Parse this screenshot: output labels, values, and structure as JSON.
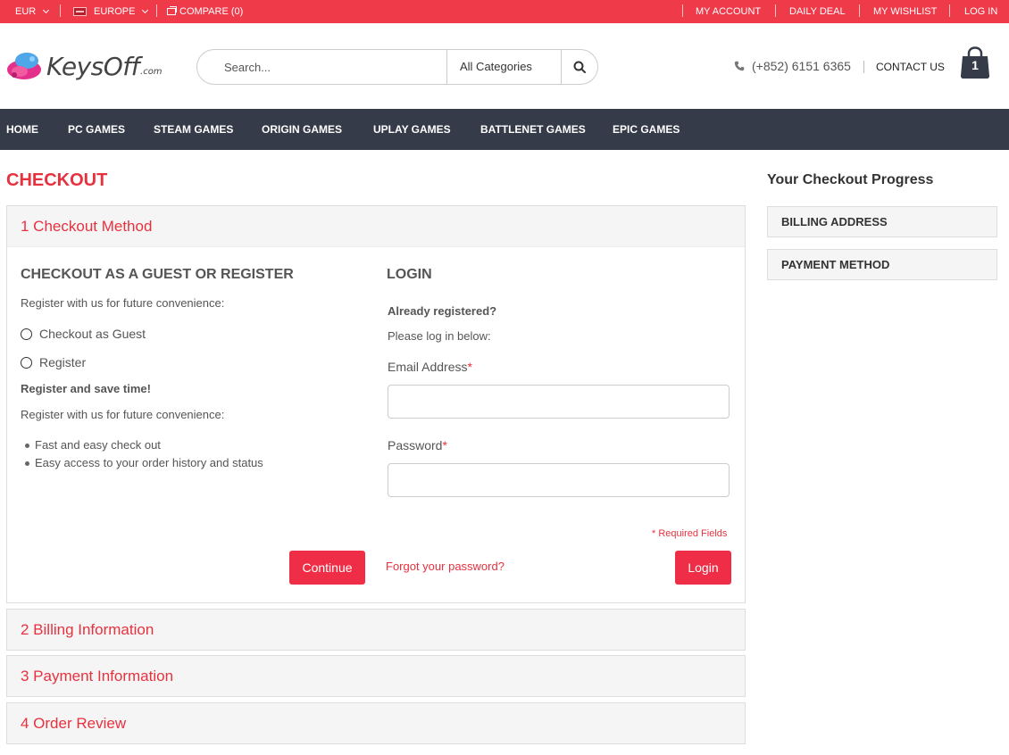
{
  "topbar": {
    "currency": "EUR",
    "region": "EUROPE",
    "compare": "COMPARE (0)",
    "links": [
      "MY ACCOUNT",
      "DAILY DEAL",
      "MY WISHLIST",
      "LOG IN"
    ]
  },
  "header": {
    "logo_text": "KeysOff",
    "logo_suffix": ".com",
    "search_placeholder": "Search...",
    "category": "All Categories",
    "phone": "(+852) 6151 6365",
    "contact": "CONTACT US",
    "cart_count": "1"
  },
  "nav": [
    "HOME",
    "PC GAMES",
    "STEAM GAMES",
    "ORIGIN GAMES",
    "UPLAY GAMES",
    "BATTLENET GAMES",
    "EPIC GAMES"
  ],
  "checkout": {
    "title": "CHECKOUT",
    "steps": [
      "1 Checkout Method",
      "2 Billing Information",
      "3 Payment Information",
      "4 Order Review"
    ],
    "guest": {
      "heading": "CHECKOUT AS A GUEST OR REGISTER",
      "intro": "Register with us for future convenience:",
      "options": [
        "Checkout as Guest",
        "Register"
      ],
      "save_time": "Register and save time!",
      "intro2": "Register with us for future convenience:",
      "benefits": [
        "Fast and easy check out",
        "Easy access to your order history and status"
      ],
      "continue_label": "Continue"
    },
    "login": {
      "heading": "LOGIN",
      "already": "Already registered?",
      "please": "Please log in below:",
      "email_label": "Email Address",
      "password_label": "Password",
      "required_mark": "*",
      "required_note": "* Required Fields",
      "forgot": "Forgot your password?",
      "login_label": "Login"
    }
  },
  "sidebar": {
    "title": "Your Checkout Progress",
    "items": [
      "BILLING ADDRESS",
      "PAYMENT METHOD"
    ]
  },
  "colors": {
    "accent": "#ef3a4a",
    "nav_bg": "#353b48"
  }
}
